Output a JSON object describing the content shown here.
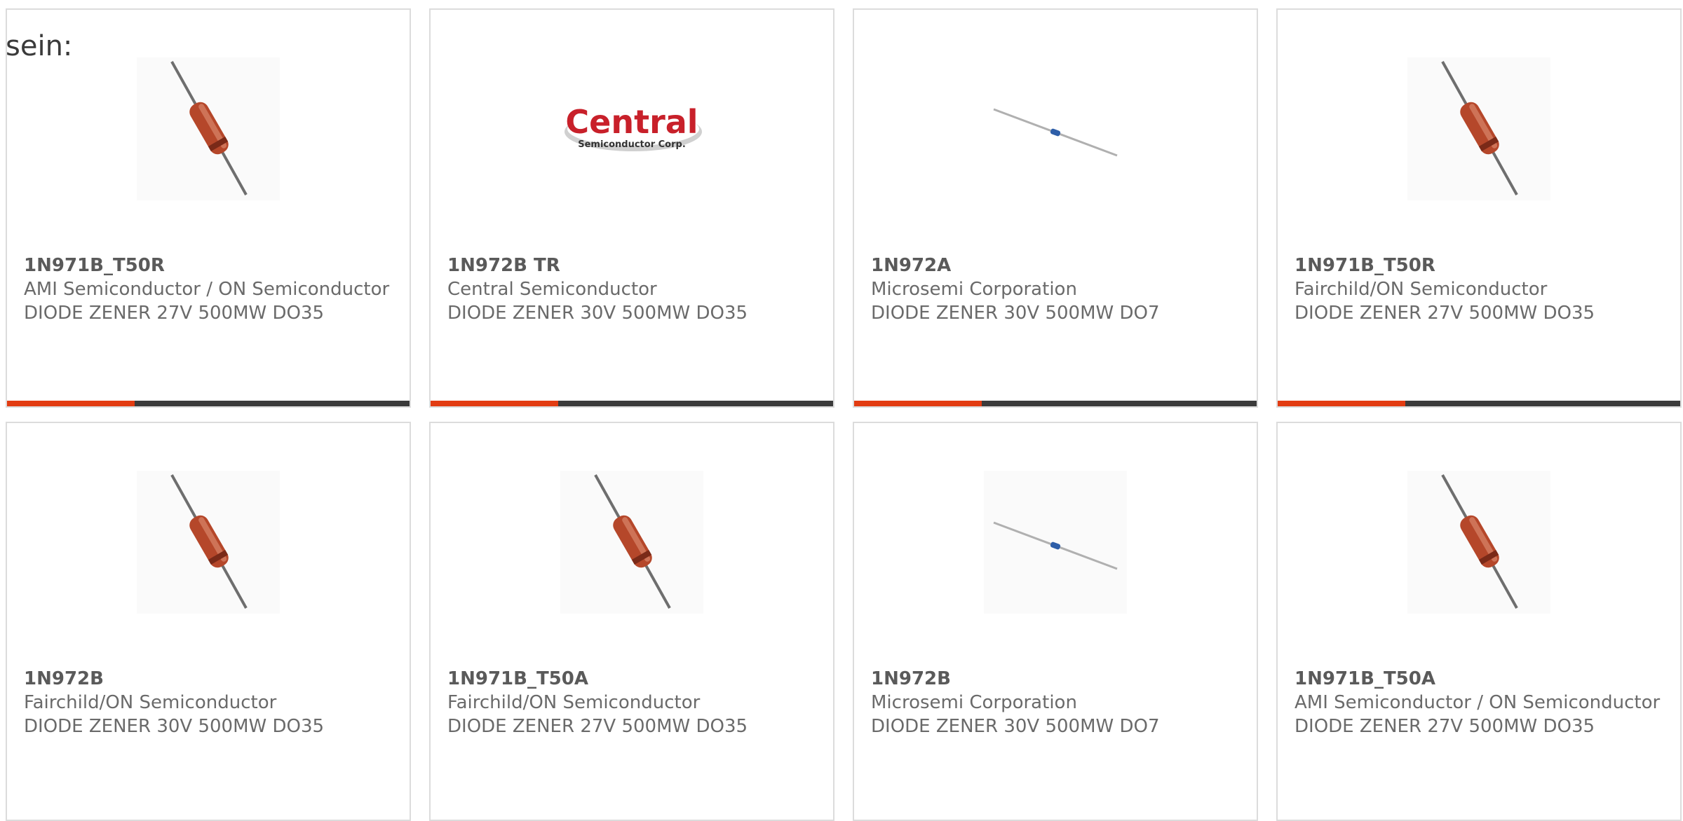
{
  "intro_text": "sein:",
  "products": [
    {
      "part": "1N971B_T50R",
      "manufacturer": "AMI Semiconductor / ON Semiconductor",
      "description": "DIODE ZENER 27V 500MW DO35",
      "image": "diode-do35-icon",
      "has_bar": true
    },
    {
      "part": "1N972B TR",
      "manufacturer": "Central Semiconductor",
      "description": "DIODE ZENER 30V 500MW DO35",
      "image": "central-semiconductor-logo",
      "logo_text": "Central",
      "logo_subtext": "Semiconductor Corp.",
      "has_bar": true
    },
    {
      "part": "1N972A",
      "manufacturer": "Microsemi Corporation",
      "description": "DIODE ZENER 30V 500MW DO7",
      "image": "diode-do7-icon",
      "has_bar": true
    },
    {
      "part": "1N971B_T50R",
      "manufacturer": "Fairchild/ON Semiconductor",
      "description": "DIODE ZENER 27V 500MW DO35",
      "image": "diode-do35-icon",
      "has_bar": true
    },
    {
      "part": "1N972B",
      "manufacturer": "Fairchild/ON Semiconductor",
      "description": "DIODE ZENER 30V 500MW DO35",
      "image": "diode-do35-icon",
      "has_bar": false
    },
    {
      "part": "1N971B_T50A",
      "manufacturer": "Fairchild/ON Semiconductor",
      "description": "DIODE ZENER 27V 500MW DO35",
      "image": "diode-do35-icon",
      "has_bar": false
    },
    {
      "part": "1N972B",
      "manufacturer": "Microsemi Corporation",
      "description": "DIODE ZENER 30V 500MW DO7",
      "image": "diode-do7-icon",
      "has_bar": false
    },
    {
      "part": "1N971B_T50A",
      "manufacturer": "AMI Semiconductor / ON Semiconductor",
      "description": "DIODE ZENER 27V 500MW DO35",
      "image": "diode-do35-icon",
      "has_bar": false
    }
  ],
  "colors": {
    "accent": "#e23c12",
    "bar": "#3b3b3b",
    "border": "#dcdcdc",
    "text": "#6a6a6a",
    "logo_red": "#c8202a"
  }
}
